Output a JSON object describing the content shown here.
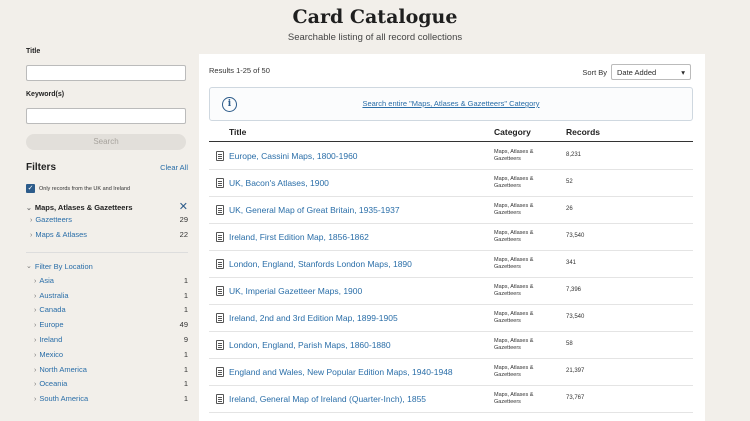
{
  "header": {
    "title": "Card Catalogue",
    "subtitle": "Searchable listing of all record collections"
  },
  "sidebar": {
    "title_label": "Title",
    "keyword_label": "Keyword(s)",
    "search_button": "Search",
    "filters_title": "Filters",
    "clear_all": "Clear All",
    "uk_checkbox_label": "Only records from the UK and Ireland",
    "category_heading": "Maps, Atlases & Gazetteers",
    "categories": [
      {
        "label": "Gazetteers",
        "count": "29"
      },
      {
        "label": "Maps & Atlases",
        "count": "22"
      }
    ],
    "location_heading": "Filter By Location",
    "locations": [
      {
        "label": "Asia",
        "count": "1"
      },
      {
        "label": "Australia",
        "count": "1"
      },
      {
        "label": "Canada",
        "count": "1"
      },
      {
        "label": "Europe",
        "count": "49"
      },
      {
        "label": "Ireland",
        "count": "9"
      },
      {
        "label": "Mexico",
        "count": "1"
      },
      {
        "label": "North America",
        "count": "1"
      },
      {
        "label": "Oceania",
        "count": "1"
      },
      {
        "label": "South America",
        "count": "1"
      }
    ]
  },
  "main": {
    "results_count": "Results 1-25 of 50",
    "sort_label": "Sort By",
    "sort_value": "Date Added",
    "info_link": "Search entire \"Maps, Atlases & Gazetteers\" Category",
    "columns": {
      "title": "Title",
      "category": "Category",
      "records": "Records"
    },
    "rows": [
      {
        "title": "Europe, Cassini Maps, 1800-1960",
        "category": "Maps, Atlases & Gazetteers",
        "records": "8,231"
      },
      {
        "title": "UK, Bacon's Atlases, 1900",
        "category": "Maps, Atlases & Gazetteers",
        "records": "52"
      },
      {
        "title": "UK, General Map of Great Britain, 1935-1937",
        "category": "Maps, Atlases & Gazetteers",
        "records": "26"
      },
      {
        "title": "Ireland, First Edition Map, 1856-1862",
        "category": "Maps, Atlases & Gazetteers",
        "records": "73,540"
      },
      {
        "title": "London, England, Stanfords London Maps, 1890",
        "category": "Maps, Atlases & Gazetteers",
        "records": "341"
      },
      {
        "title": "UK, Imperial Gazetteer Maps, 1900",
        "category": "Maps, Atlases & Gazetteers",
        "records": "7,396"
      },
      {
        "title": "Ireland, 2nd and 3rd Edition Map, 1899-1905",
        "category": "Maps, Atlases & Gazetteers",
        "records": "73,540"
      },
      {
        "title": "London, England, Parish Maps, 1860-1880",
        "category": "Maps, Atlases & Gazetteers",
        "records": "58"
      },
      {
        "title": "England and Wales, New Popular Edition Maps, 1940-1948",
        "category": "Maps, Atlases & Gazetteers",
        "records": "21,397"
      },
      {
        "title": "Ireland, General Map of Ireland (Quarter-Inch), 1855",
        "category": "Maps, Atlases & Gazetteers",
        "records": "73,767"
      }
    ]
  }
}
